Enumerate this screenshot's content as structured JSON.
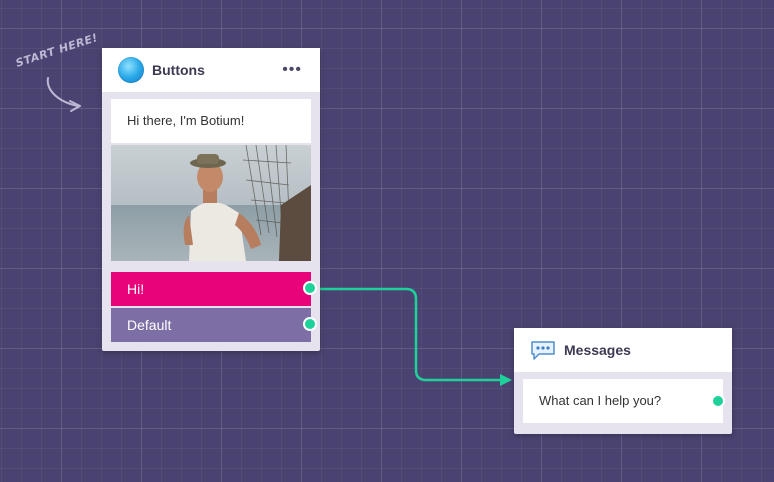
{
  "canvas": {
    "start_hint": "START HERE!"
  },
  "colors": {
    "background": "#4a4371",
    "accent_green": "#1ed19a",
    "button_primary": "#e8037b",
    "button_secondary": "#7e6ea6"
  },
  "nodes": {
    "buttons": {
      "title": "Buttons",
      "icon": "bot-avatar-icon",
      "menu_icon": "more-dots-icon",
      "message": "Hi there, I'm Botium!",
      "image": "fisherman-photo",
      "buttons": [
        {
          "label": "Hi!"
        },
        {
          "label": "Default"
        }
      ]
    },
    "messages": {
      "title": "Messages",
      "icon": "chat-bubble-icon",
      "message": "What can I help you?"
    }
  }
}
